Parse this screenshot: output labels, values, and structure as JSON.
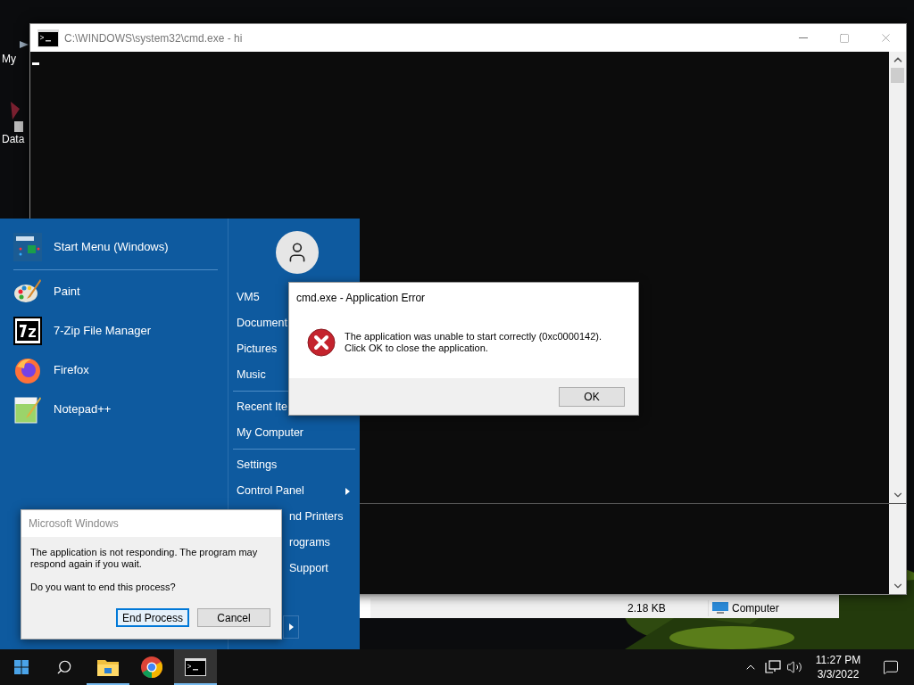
{
  "desktop": {
    "icons": [
      {
        "label": "My",
        "kind": "computer"
      },
      {
        "label": "Data",
        "kind": "file"
      }
    ]
  },
  "explorer_status_bar": {
    "size": "2.18 KB",
    "location": "Computer"
  },
  "cmd_window": {
    "title": "C:\\WINDOWS\\system32\\cmd.exe - hi"
  },
  "start_menu": {
    "header": "Start Menu (Windows)",
    "programs": [
      {
        "label": "Paint",
        "kind": "paint"
      },
      {
        "label": "7-Zip File Manager",
        "kind": "zip"
      },
      {
        "label": "Firefox",
        "kind": "firefox"
      },
      {
        "label": "Notepad++",
        "kind": "notepad"
      }
    ],
    "place_groups": [
      [
        {
          "label": "VM5",
          "kind": "full"
        },
        {
          "label": "Document",
          "kind": "full"
        },
        {
          "label": "Pictures",
          "kind": "full"
        },
        {
          "label": "Music",
          "kind": "full"
        }
      ],
      [
        {
          "label": "Recent Ite",
          "kind": "full"
        },
        {
          "label": "My Computer",
          "kind": "full"
        }
      ],
      [
        {
          "label": "Settings",
          "kind": "full"
        },
        {
          "label": "Control Panel",
          "kind": "submenu"
        },
        {
          "label": "nd Printers",
          "kind": "cut_left"
        },
        {
          "label": "rograms",
          "kind": "cut_left"
        },
        {
          "label": "Support",
          "kind": "cut_left"
        }
      ]
    ]
  },
  "error_dialog": {
    "title": "cmd.exe - Application Error",
    "message_lines": [
      "The application was unable to start correctly (0xc0000142).",
      "Click OK to close the application."
    ],
    "button": "OK"
  },
  "hang_dialog": {
    "title": "Microsoft Windows",
    "message": "The application is not responding. The program may respond again if you wait.",
    "question": "Do you want to end this process?",
    "buttons": [
      {
        "label": "End Process",
        "default": true
      },
      {
        "label": "Cancel",
        "default": false
      }
    ]
  },
  "taskbar": {
    "apps": [
      {
        "kind": "explorer",
        "running": true,
        "active": false
      },
      {
        "kind": "chrome",
        "running": false,
        "active": false
      },
      {
        "kind": "console",
        "running": true,
        "active": true
      }
    ],
    "clock": {
      "time": "11:27 PM",
      "date": "3/3/2022"
    }
  }
}
